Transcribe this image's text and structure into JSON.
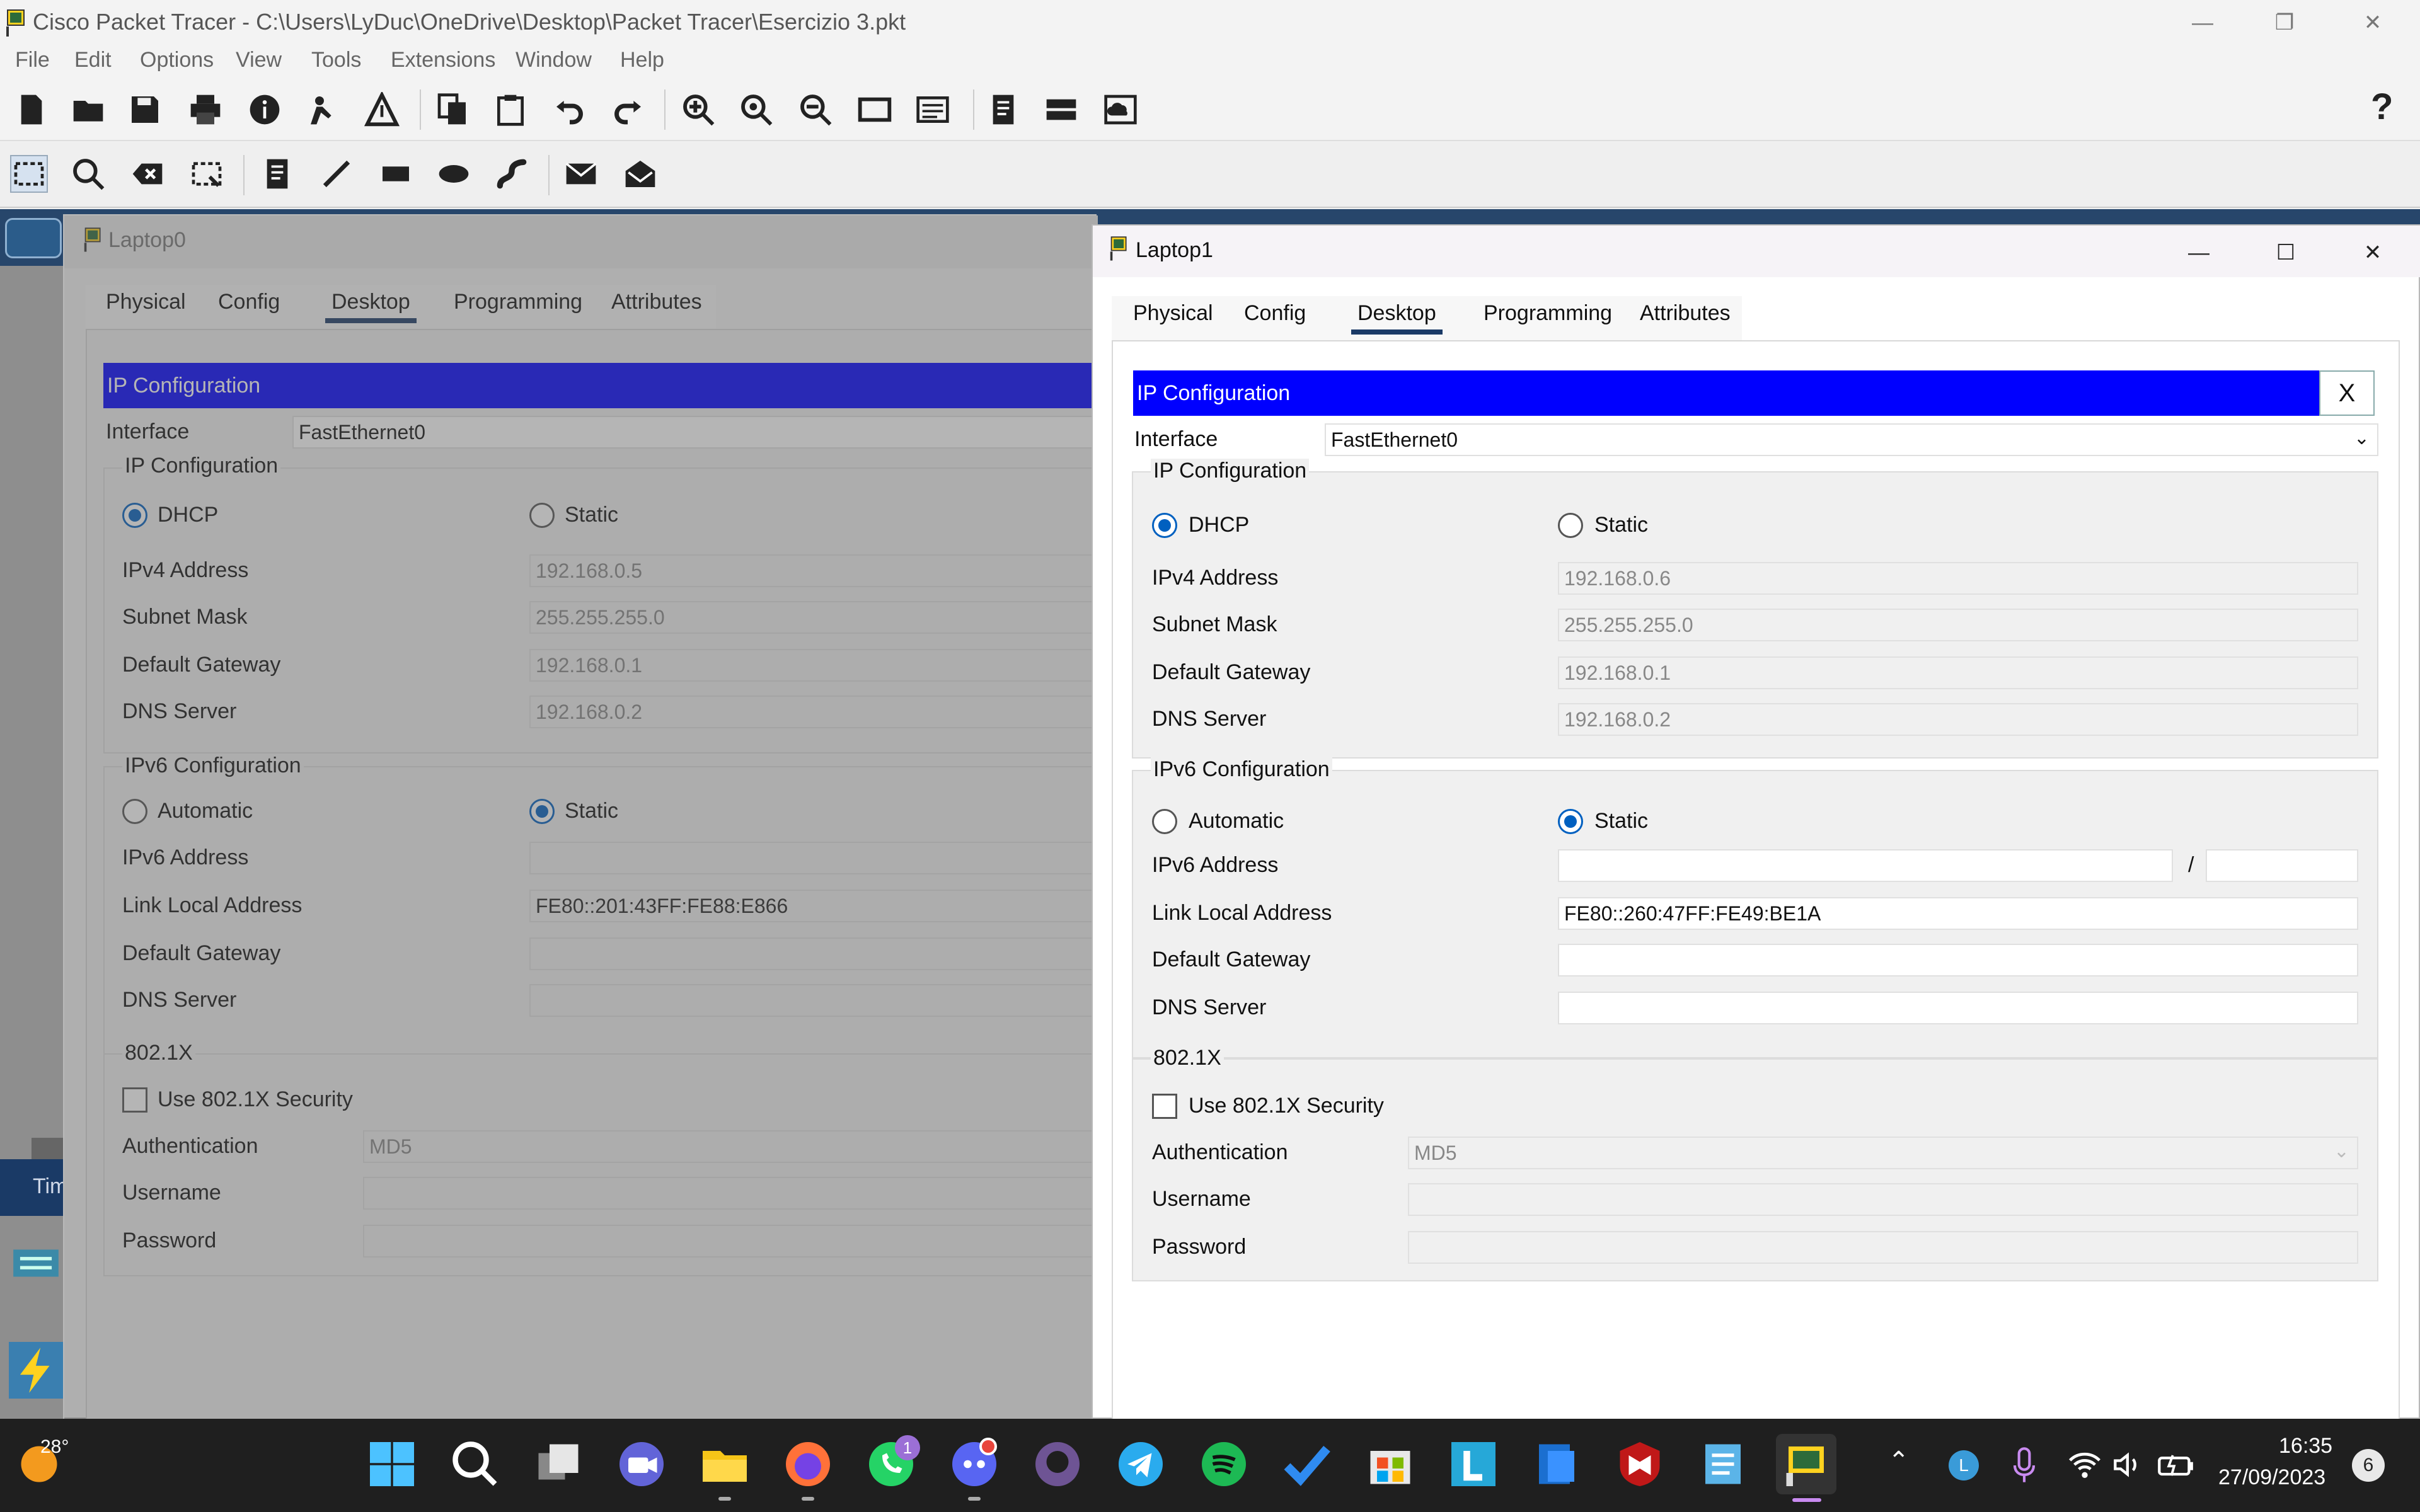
{
  "app": {
    "title": "Cisco Packet Tracer - C:\\Users\\LyDuc\\OneDrive\\Desktop\\Packet Tracer\\Esercizio 3.pkt",
    "menu": [
      "File",
      "Edit",
      "Options",
      "View",
      "Tools",
      "Extensions",
      "Window",
      "Help"
    ],
    "help_glyph": "?"
  },
  "laptop0": {
    "title": "Laptop0",
    "tabs": [
      "Physical",
      "Config",
      "Desktop",
      "Programming",
      "Attributes"
    ],
    "active_tab": "Desktop",
    "header": "IP Configuration",
    "interface_label": "Interface",
    "interface_value": "FastEthernet0",
    "ipv4": {
      "group": "IP Configuration",
      "dhcp": "DHCP",
      "static": "Static",
      "mode": "DHCP",
      "ipv4_label": "IPv4 Address",
      "ipv4_value": "192.168.0.5",
      "mask_label": "Subnet Mask",
      "mask_value": "255.255.255.0",
      "gw_label": "Default Gateway",
      "gw_value": "192.168.0.1",
      "dns_label": "DNS Server",
      "dns_value": "192.168.0.2"
    },
    "ipv6": {
      "group": "IPv6 Configuration",
      "automatic": "Automatic",
      "static": "Static",
      "mode": "Static",
      "addr_label": "IPv6 Address",
      "addr_value": "",
      "link_label": "Link Local Address",
      "link_value": "FE80::201:43FF:FE88:E866",
      "gw_label": "Default Gateway",
      "gw_value": "",
      "dns_label": "DNS Server",
      "dns_value": ""
    },
    "dot1x": {
      "group": "802.1X",
      "use": "Use 802.1X Security",
      "auth_label": "Authentication",
      "auth_value": "MD5",
      "user_label": "Username",
      "pass_label": "Password"
    }
  },
  "laptop1": {
    "title": "Laptop1",
    "tabs": [
      "Physical",
      "Config",
      "Desktop",
      "Programming",
      "Attributes"
    ],
    "active_tab": "Desktop",
    "header": "IP Configuration",
    "close_glyph": "X",
    "interface_label": "Interface",
    "interface_value": "FastEthernet0",
    "ipv4": {
      "group": "IP Configuration",
      "dhcp": "DHCP",
      "static": "Static",
      "mode": "DHCP",
      "ipv4_label": "IPv4 Address",
      "ipv4_value": "192.168.0.6",
      "mask_label": "Subnet Mask",
      "mask_value": "255.255.255.0",
      "gw_label": "Default Gateway",
      "gw_value": "192.168.0.1",
      "dns_label": "DNS Server",
      "dns_value": "192.168.0.2"
    },
    "ipv6": {
      "group": "IPv6 Configuration",
      "automatic": "Automatic",
      "static": "Static",
      "mode": "Static",
      "addr_label": "IPv6 Address",
      "addr_value": "",
      "prefix_sep": "/",
      "prefix_value": "",
      "link_label": "Link Local Address",
      "link_value": "FE80::260:47FF:FE49:BE1A",
      "gw_label": "Default Gateway",
      "gw_value": "",
      "dns_label": "DNS Server",
      "dns_value": ""
    },
    "dot1x": {
      "group": "802.1X",
      "use": "Use 802.1X Security",
      "auth_label": "Authentication",
      "auth_value": "MD5",
      "user_label": "Username",
      "pass_label": "Password"
    }
  },
  "workspace": {
    "side_label": "Tim"
  },
  "taskbar": {
    "weather": "28°",
    "whatsapp_badge": "1",
    "time": "16:35",
    "date": "27/09/2023",
    "notif_count": "6",
    "tray_letter": "L"
  },
  "colors": {
    "header_blue": "#0000ff",
    "tab_underline": "#1a3a66",
    "radio_on": "#0060c0",
    "taskbar": "#1f1f1f"
  }
}
